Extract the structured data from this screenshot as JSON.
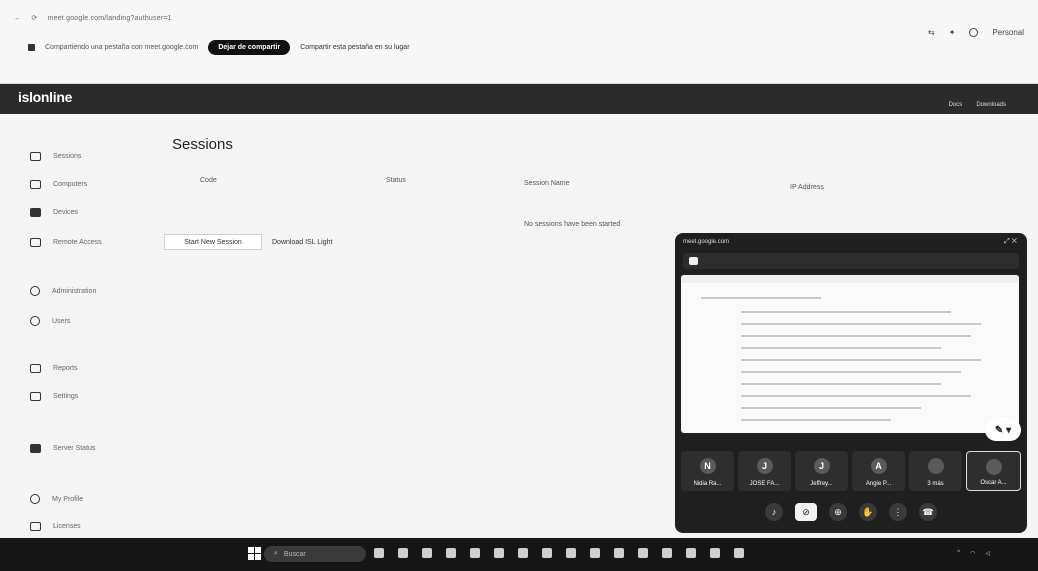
{
  "browser": {
    "url_text": "meet.google.com/landing?authuser=1",
    "share_text": "Compartiendo una pestaña con meet.google.com",
    "stop_share_label": "Dejar de compartir",
    "share_this_tab_label": "Compartir esta pestaña en su lugar",
    "info_text": "",
    "profile_label": "Personal"
  },
  "app": {
    "logo": "islonline",
    "header_links": [
      "Docs",
      "Downloads"
    ],
    "account_label": ""
  },
  "sidebar": {
    "sections": [
      "",
      "",
      "",
      "",
      ""
    ],
    "items": [
      {
        "label": "Sessions",
        "icon": "screen-icon"
      },
      {
        "label": "Computers",
        "icon": "screen-icon"
      },
      {
        "label": "Devices",
        "icon": "device-icon"
      },
      {
        "label": "Remote Access",
        "icon": "screen-icon"
      },
      {
        "label": "Administration",
        "icon": "gear-icon"
      },
      {
        "label": "Users",
        "icon": "users-icon"
      },
      {
        "label": "Reports",
        "icon": "chart-icon"
      },
      {
        "label": "Settings",
        "icon": "chart-icon"
      },
      {
        "label": "Server Status",
        "icon": "server-icon"
      },
      {
        "label": "My Profile",
        "icon": "profile-icon"
      },
      {
        "label": "Licenses",
        "icon": "license-icon"
      }
    ]
  },
  "main": {
    "title": "Sessions",
    "columns": [
      "Code",
      "Status",
      "Session Name",
      "IP Address"
    ],
    "empty_message": "No sessions have been started",
    "start_button": "Start New Session",
    "download_link": "Download ISL Light"
  },
  "meet": {
    "host_label": "meet.google.com",
    "title": "",
    "fab_label": "✎ ▾",
    "participants": [
      {
        "initial": "N",
        "name": "Nidia Ra..."
      },
      {
        "initial": "J",
        "name": "JOSE FA..."
      },
      {
        "initial": "J",
        "name": "Jeffrey..."
      },
      {
        "initial": "A",
        "name": "Angie P..."
      },
      {
        "initial": "",
        "name": "3 más"
      },
      {
        "initial": "",
        "name": "Oscar A..."
      }
    ]
  },
  "taskbar": {
    "weather": "",
    "weather_sub": "",
    "search_label": "Buscar",
    "time": "",
    "date": ""
  }
}
